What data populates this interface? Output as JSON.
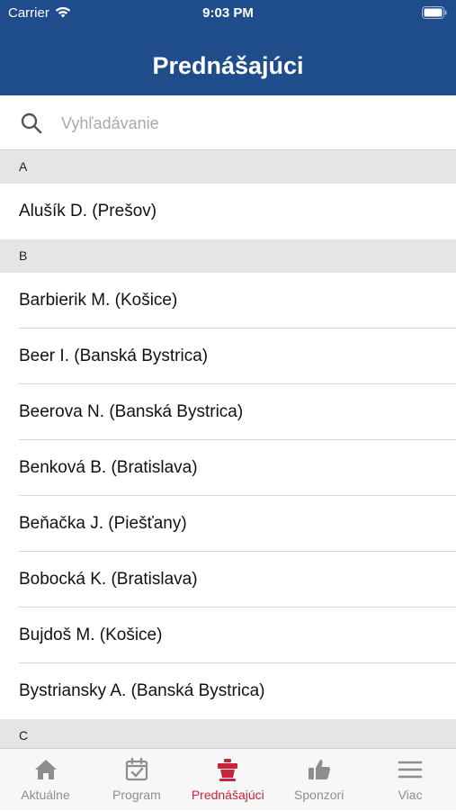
{
  "status_bar": {
    "carrier": "Carrier",
    "time": "9:03 PM"
  },
  "header": {
    "title": "Prednášajúci"
  },
  "search": {
    "placeholder": "Vyhľadávanie",
    "value": ""
  },
  "sections": [
    {
      "letter": "A",
      "items": [
        "Alušík D. (Prešov)"
      ]
    },
    {
      "letter": "B",
      "items": [
        "Barbierik M. (Košice)",
        "Beer I. (Banská Bystrica)",
        "Beerova N. (Banská Bystrica)",
        "Benková B. (Bratislava)",
        "Beňačka J. (Piešťany)",
        "Bobocká K. (Bratislava)",
        "Bujdoš M. (Košice)",
        "Bystriansky A. (Banská Bystrica)"
      ]
    },
    {
      "letter": "C",
      "items": []
    }
  ],
  "tabs": [
    {
      "label": "Aktuálne",
      "icon": "home-icon",
      "active": false
    },
    {
      "label": "Program",
      "icon": "calendar-check-icon",
      "active": false
    },
    {
      "label": "Prednášajúci",
      "icon": "lectern-icon",
      "active": true
    },
    {
      "label": "Sponzori",
      "icon": "thumbs-up-icon",
      "active": false
    },
    {
      "label": "Viac",
      "icon": "menu-icon",
      "active": false
    }
  ],
  "colors": {
    "header_bg": "#1f4d8c",
    "active_tab": "#c8243c",
    "inactive_tab": "#8e8e8e"
  }
}
